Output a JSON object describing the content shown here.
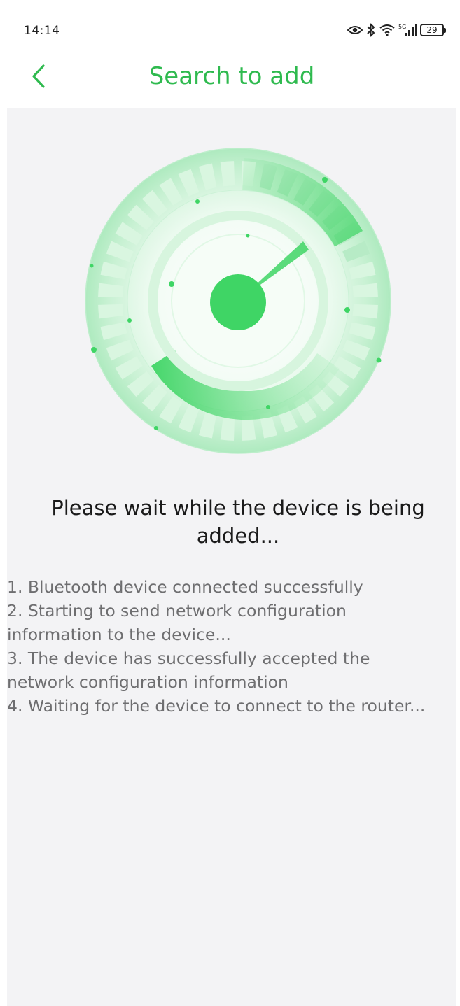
{
  "status_bar": {
    "time": "14:14",
    "network_label": "5G",
    "battery": "29"
  },
  "header": {
    "title": "Search to add"
  },
  "colors": {
    "accent": "#2fba4f",
    "radar_green": "#3fd565",
    "background": "#f3f3f5"
  },
  "main": {
    "headline": "Please wait while the device is being added...",
    "steps": [
      "1. Bluetooth device connected successfully",
      "2. Starting to send network configuration\ninformation to the device...",
      "3. The device has successfully accepted the\nnetwork configuration information",
      "4. Waiting for the device to connect to the router..."
    ]
  }
}
